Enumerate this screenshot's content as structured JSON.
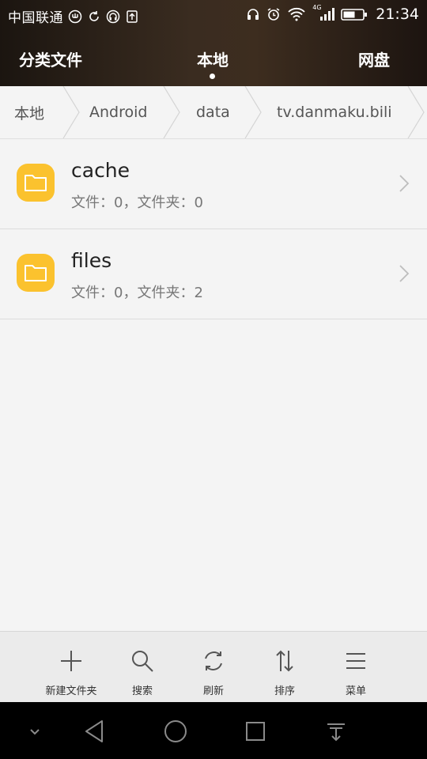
{
  "status_bar": {
    "carrier": "中国联通",
    "network_label": "4G",
    "time": "21:34"
  },
  "top_tabs": {
    "items": [
      {
        "label": "分类文件",
        "active": false
      },
      {
        "label": "本地",
        "active": true
      },
      {
        "label": "网盘",
        "active": false
      }
    ]
  },
  "breadcrumb": {
    "items": [
      "本地",
      "Android",
      "data",
      "tv.danmaku.bili"
    ]
  },
  "files": [
    {
      "name": "cache",
      "meta": "文件：0，文件夹：0",
      "icon": "folder-icon"
    },
    {
      "name": "files",
      "meta": "文件：0，文件夹：2",
      "icon": "folder-icon"
    }
  ],
  "toolbar": {
    "new_folder": "新建文件夹",
    "search": "搜索",
    "refresh": "刷新",
    "sort": "排序",
    "menu": "菜单"
  },
  "colors": {
    "folder": "#fbc22e",
    "header_dark": "#1b1510",
    "header_mid": "#3d2d1f"
  }
}
